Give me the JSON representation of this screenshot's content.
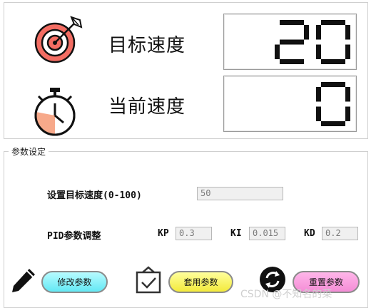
{
  "top": {
    "target_label": "目标速度",
    "target_value": "20",
    "current_label": "当前速度",
    "current_value": "0"
  },
  "params": {
    "group_title": "参数设定",
    "set_target_label": "设置目标速度(0-100)",
    "target_input_value": "50",
    "pid_label": "PID参数调整",
    "kp_label": "KP",
    "kp_value": "0.3",
    "ki_label": "KI",
    "ki_value": "0.015",
    "kd_label": "KD",
    "kd_value": "0.2"
  },
  "buttons": {
    "modify": "修改参数",
    "apply": "套用参数",
    "reset": "重置参数"
  },
  "icons": {
    "target": "target-icon",
    "stopwatch": "stopwatch-icon",
    "pen": "pen-icon",
    "apply": "checkbox-icon",
    "reset": "refresh-icon"
  },
  "watermark": "CSDN @不知名的菜"
}
